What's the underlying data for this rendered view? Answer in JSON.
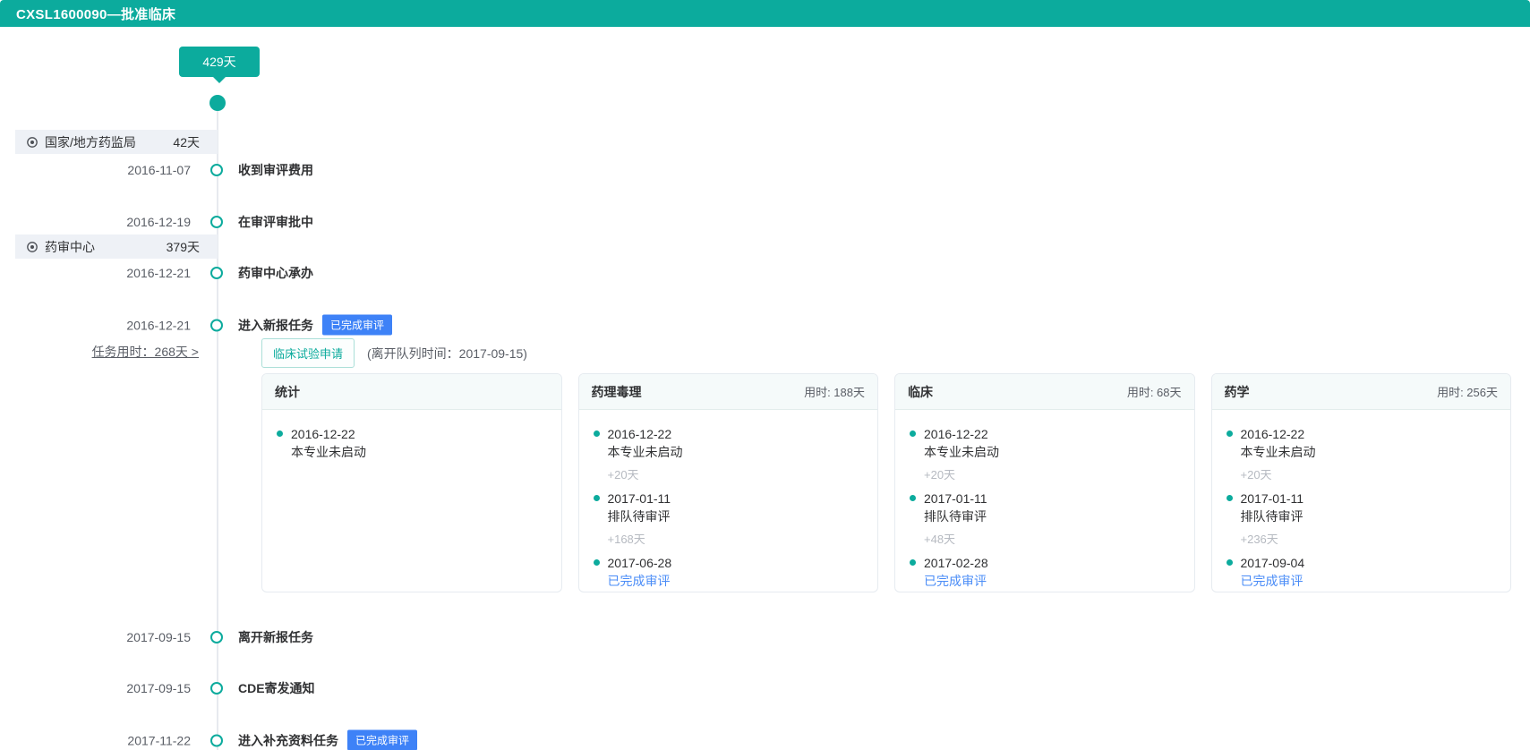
{
  "header": {
    "title": "CXSL1600090—批准临床"
  },
  "summary": {
    "total_days": "429天"
  },
  "org_bars": [
    {
      "name": "国家/地方药监局",
      "days": "42天"
    },
    {
      "name": "药审中心",
      "days": "379天"
    }
  ],
  "events": [
    {
      "date": "2016-11-07",
      "label": "收到审评费用"
    },
    {
      "date": "2016-12-19",
      "label": "在审评审批中"
    },
    {
      "date": "2016-12-21",
      "label": "药审中心承办"
    },
    {
      "date": "2016-12-21",
      "label": "进入新报任务",
      "badge": "已完成审评"
    },
    {
      "date": "2017-09-15",
      "label": "离开新报任务"
    },
    {
      "date": "2017-09-15",
      "label": "CDE寄发通知"
    },
    {
      "date": "2017-11-22",
      "label": "进入补充资料任务",
      "badge": "已完成审评"
    }
  ],
  "task": {
    "duration_link": "任务用时：268天 >",
    "tag": "临床试验申请",
    "queue_note": "(离开队列时间：2017-09-15)"
  },
  "cards": [
    {
      "title": "统计",
      "duration": "",
      "entries": [
        {
          "date": "2016-12-22",
          "status": "本专业未启动"
        }
      ],
      "gaps": []
    },
    {
      "title": "药理毒理",
      "duration": "用时: 188天",
      "entries": [
        {
          "date": "2016-12-22",
          "status": "本专业未启动"
        },
        {
          "date": "2017-01-11",
          "status": "排队待审评"
        },
        {
          "date": "2017-06-28",
          "status": "已完成审评"
        }
      ],
      "gaps": [
        "+20天",
        "+168天"
      ]
    },
    {
      "title": "临床",
      "duration": "用时: 68天",
      "entries": [
        {
          "date": "2016-12-22",
          "status": "本专业未启动"
        },
        {
          "date": "2017-01-11",
          "status": "排队待审评"
        },
        {
          "date": "2017-02-28",
          "status": "已完成审评"
        }
      ],
      "gaps": [
        "+20天",
        "+48天"
      ]
    },
    {
      "title": "药学",
      "duration": "用时: 256天",
      "entries": [
        {
          "date": "2016-12-22",
          "status": "本专业未启动"
        },
        {
          "date": "2017-01-11",
          "status": "排队待审评"
        },
        {
          "date": "2017-09-04",
          "status": "已完成审评"
        }
      ],
      "gaps": [
        "+20天",
        "+236天"
      ]
    }
  ],
  "colors": {
    "teal": "#0cab9d",
    "blue": "#3e82f7",
    "link": "#4a8cf7"
  }
}
